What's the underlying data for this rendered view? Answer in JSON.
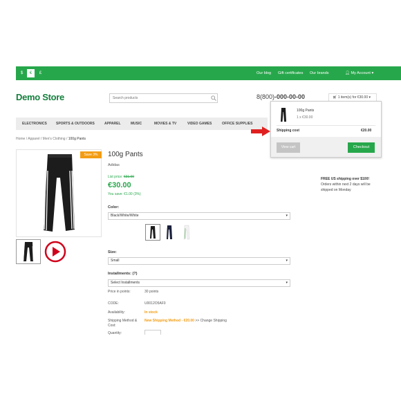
{
  "colors": {
    "brand": "#27a74b",
    "orange": "#f39c12",
    "red_arrow": "#e02020"
  },
  "topbar": {
    "currencies": [
      "$",
      "€",
      "£"
    ],
    "links": [
      "Our blog",
      "Gift certificates",
      "Our brands"
    ],
    "account": "My Account"
  },
  "header": {
    "logo": "Demo Store",
    "search_placeholder": "Search products",
    "phone_prefix": "8(800)",
    "phone_number": "-000-00-00",
    "cart": "1 item(s) for €30.00"
  },
  "menu": [
    "ELECTRONICS",
    "SPORTS & OUTDOORS",
    "APPAREL",
    "MUSIC",
    "MOVIES & TV",
    "VIDEO GAMES",
    "OFFICE SUPPLIES"
  ],
  "breadcrumbs": [
    "Home",
    "Apparel",
    "Men's Clothing",
    "100g Pants"
  ],
  "product": {
    "badge": "Save 3%",
    "title": "100g Pants",
    "brand": "Adidas",
    "list_price_label": "List price:",
    "list_price": "€31.00",
    "price": "€30.00",
    "you_save": "You save: €1.00 (3%)",
    "color_label": "Color:",
    "color_value": "Black/White/White",
    "size_label": "Size:",
    "size_value": "Small",
    "installments_label": "Installments:",
    "installments_help": "(?)",
    "installments_value": "Select Installments",
    "points_label": "Price in points:",
    "points_value": "30 points",
    "code_label": "CODE:",
    "code_value": "U0012O5AF0",
    "availability_label": "Availability:",
    "availability_value": "In stock",
    "shipping_label_1": "Shipping Method &",
    "shipping_label_2": "Cost:",
    "shipping_method": "New Shipping Method - €20.00",
    "change_shipping": ">> Change Shipping",
    "quantity_label": "Quantity:"
  },
  "shipping_info": {
    "title": "FREE US shipping over $100!",
    "line1": "Orders within next 2 days will be",
    "line2": "shipped on Monday"
  },
  "cart_dropdown": {
    "item_name": "100g Pants",
    "item_qty": "1 x €30.00",
    "shipping_label": "Shipping cost",
    "shipping_value": "€20.00",
    "view_cart": "View cart",
    "checkout": "Checkout"
  }
}
